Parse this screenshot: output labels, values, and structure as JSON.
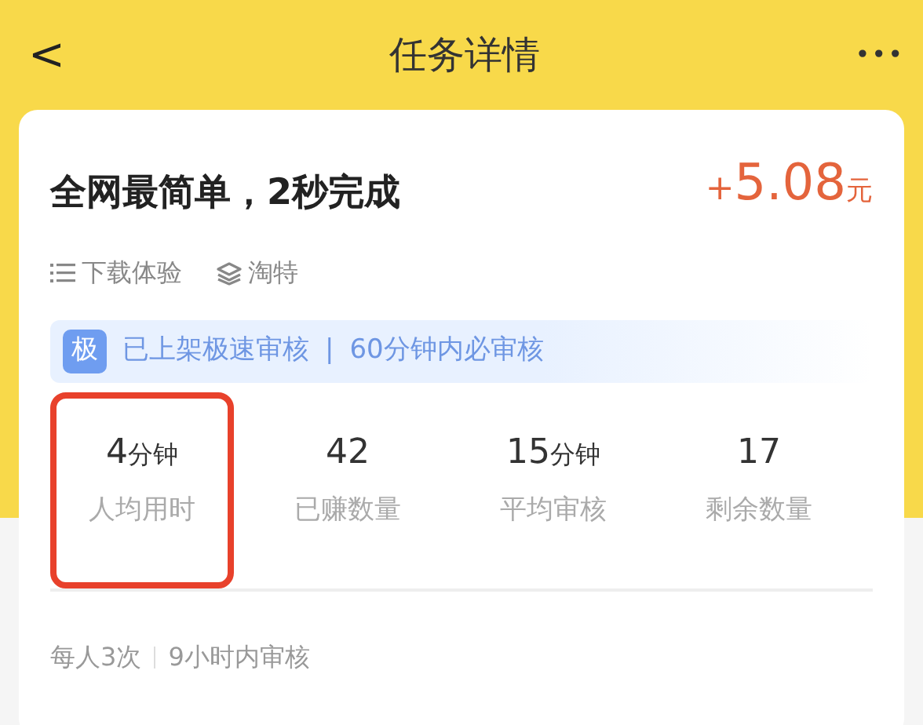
{
  "header": {
    "back": "<",
    "title": "任务详情",
    "more": "•••"
  },
  "task": {
    "title": "全网最简单，2秒完成",
    "reward": {
      "sign": "+",
      "amount": "5.08",
      "unit": "元"
    }
  },
  "tags": [
    {
      "kind": "list",
      "label": "下载体验"
    },
    {
      "kind": "layers",
      "label": "淘特"
    }
  ],
  "banner": {
    "badge": "极",
    "text": "已上架极速审核",
    "separator": "|",
    "note": "60分钟内必审核"
  },
  "stats": [
    {
      "value": "4",
      "unit": "分钟",
      "label": "人均用时",
      "highlighted": true
    },
    {
      "value": "42",
      "label": "已赚数量",
      "highlighted": false
    },
    {
      "value": "15",
      "unit": "分钟",
      "label": "平均审核",
      "highlighted": false
    },
    {
      "value": "17",
      "label": "剩余数量",
      "highlighted": false
    }
  ],
  "footer": [
    "每人3次",
    "9小时内审核"
  ]
}
